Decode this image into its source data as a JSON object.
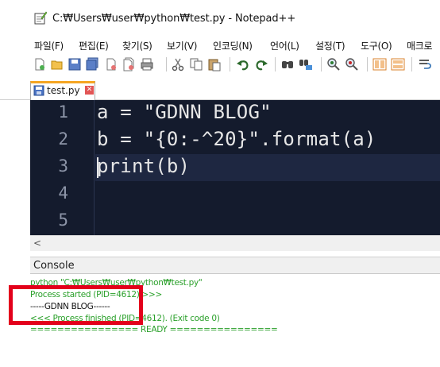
{
  "window": {
    "title": "C:₩Users₩user₩python₩test.py - Notepad++",
    "icon": "notepad-plus-plus-icon"
  },
  "menu": {
    "items": [
      "파일(F)",
      "편집(E)",
      "찾기(S)",
      "보기(V)",
      "인코딩(N)",
      "언어(L)",
      "설정(T)",
      "도구(O)",
      "매크로"
    ]
  },
  "toolbar": {
    "icons": [
      "new-file-icon",
      "open-file-icon",
      "save-icon",
      "save-all-icon",
      "close-icon",
      "close-all-icon",
      "print-icon",
      "cut-icon",
      "copy-icon",
      "paste-icon",
      "undo-icon",
      "redo-icon",
      "find-icon",
      "replace-icon",
      "zoom-in-icon",
      "zoom-out-icon",
      "sync-vertical-icon",
      "sync-horizontal-icon",
      "word-wrap-icon"
    ]
  },
  "tab": {
    "label": "test.py",
    "close_label": "✕",
    "accent_color": "#f5a623"
  },
  "editor": {
    "background": "#141b2d",
    "line_numbers": [
      "1",
      "2",
      "3",
      "4",
      "5"
    ],
    "lines": [
      "a = \"GDNN BLOG\"",
      "b = \"{0:-^20}\".format(a)",
      "print(b)",
      "",
      ""
    ]
  },
  "scrollbar": {
    "left_arrow": "<"
  },
  "console": {
    "title": "Console",
    "lines": [
      {
        "text": "python \"C:₩Users₩user₩python₩test.py\"",
        "color": "green"
      },
      {
        "text": "Process started (PID=4612) >>>",
        "color": "green"
      },
      {
        "text": "-----GDNN BLOG------",
        "color": "black"
      },
      {
        "text": "<<< Process finished (PID=4612). (Exit code 0)",
        "color": "green"
      },
      {
        "text": "================ READY ================",
        "color": "green"
      }
    ]
  },
  "annotation": {
    "highlight_color": "#e3001b"
  }
}
